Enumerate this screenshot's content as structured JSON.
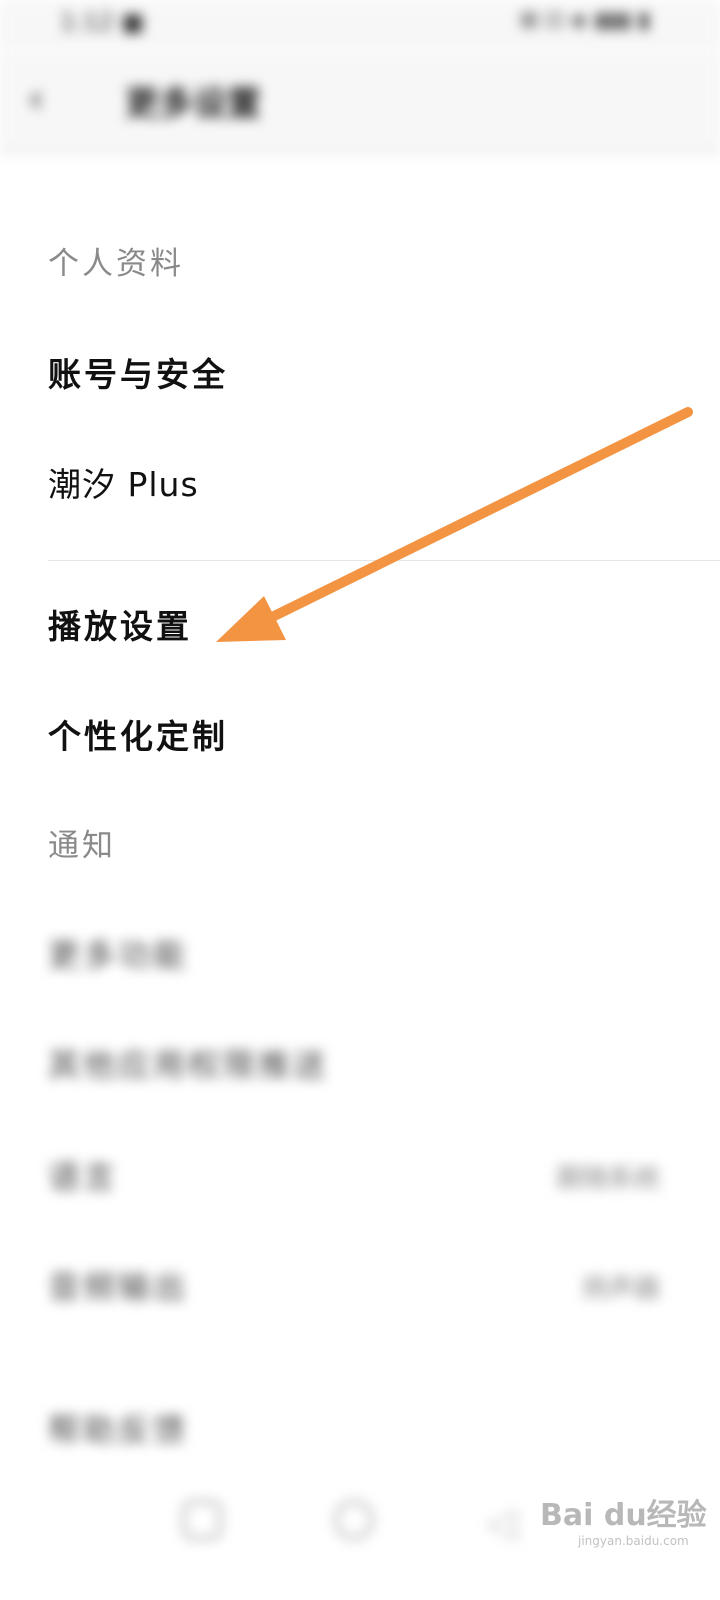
{
  "status_bar": {
    "time": "1:12 ■",
    "icons": "⊠ ⊡ ◈ ▮▮▮ ▮"
  },
  "app_bar": {
    "back_icon": "back-icon",
    "title": "更多设置"
  },
  "sections": [
    {
      "header": "个人资料",
      "items": [
        "账号与安全",
        "潮汐 Plus"
      ]
    },
    {
      "items": [
        "播放设置",
        "个性化定制"
      ]
    },
    {
      "header": "通知"
    }
  ],
  "blurred_rows": [
    {
      "label": "更多功能"
    },
    {
      "label": "其他应用权限推送"
    },
    {
      "label": "语言",
      "value": "跟随系统"
    },
    {
      "label": "音频输出",
      "value": "扬声器"
    },
    {
      "label": "帮助反馈"
    }
  ],
  "watermark": {
    "brand": "Bai du经验",
    "url": "jingyan.baidu.com"
  },
  "colors": {
    "arrow": "#f39442",
    "primary_text": "#111111",
    "section_text": "#8a8a8a"
  }
}
